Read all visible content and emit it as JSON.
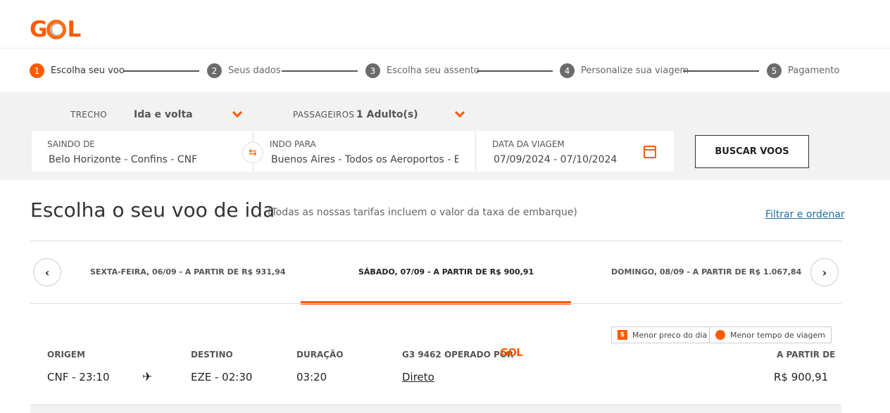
{
  "header": {
    "logo_text": "GOL"
  },
  "steps": [
    {
      "num": "1",
      "label": "Escolha seu voo"
    },
    {
      "num": "2",
      "label": "Seus dados"
    },
    {
      "num": "3",
      "label": "Escolha seu assento"
    },
    {
      "num": "4",
      "label": "Personalize sua viagem"
    },
    {
      "num": "5",
      "label": "Pagamento"
    }
  ],
  "search": {
    "trecho_label": "TRECHO",
    "trecho_value": "Ida e volta",
    "passageiros_label": "PASSAGEIROS",
    "passageiros_value": "1 Adulto(s)",
    "origin_label": "SAINDO DE",
    "origin_value": "Belo Horizonte  -  Confins - CNF",
    "dest_label": "INDO PARA",
    "dest_value": "Buenos Aires - Todos os Aeroportos - BUE",
    "date_label": "DATA DA VIAGEM",
    "date_value": "07/09/2024  -  07/10/2024",
    "button_label": "BUSCAR VOOS"
  },
  "results": {
    "title": "Escolha o seu voo de ida",
    "subtitle": "(Todas as nossas tarifas incluem o valor da taxa de embarque)",
    "filter_link": "Filtrar e ordenar",
    "days": [
      {
        "label": "SEXTA-FEIRA, 06/09 - A PARTIR DE R$ 931,94"
      },
      {
        "label": "SÁBADO, 07/09 - A PARTIR DE R$ 900,91"
      },
      {
        "label": "DOMINGO, 08/09 - A PARTIR DE R$ 1.067,84"
      }
    ],
    "badges": {
      "cheapest": "Menor preco do dia",
      "fastest": "Menor tempo de viagem"
    },
    "flight": {
      "origem_h": "ORIGEM",
      "destino_h": "DESTINO",
      "duracao_h": "DURAÇÃO",
      "operado_h": "G3 9462 OPERADO POR",
      "preco_h": "A PARTIR DE",
      "origem": "CNF - 23:10",
      "destino": "EZE - 02:30",
      "duracao": "03:20",
      "tipo": "Direto",
      "preco": "R$ 900,91",
      "operator_logo": "GOL"
    }
  },
  "colors": {
    "accent": "#ff5a00",
    "link": "#1f6fa0",
    "search_bg": "#f2f2f2"
  },
  "icons": [
    "swap-icon",
    "calendar-icon",
    "chevron-down-icon",
    "chevron-left-icon",
    "chevron-right-icon",
    "plane-icon",
    "dollar-icon",
    "clock-icon"
  ]
}
